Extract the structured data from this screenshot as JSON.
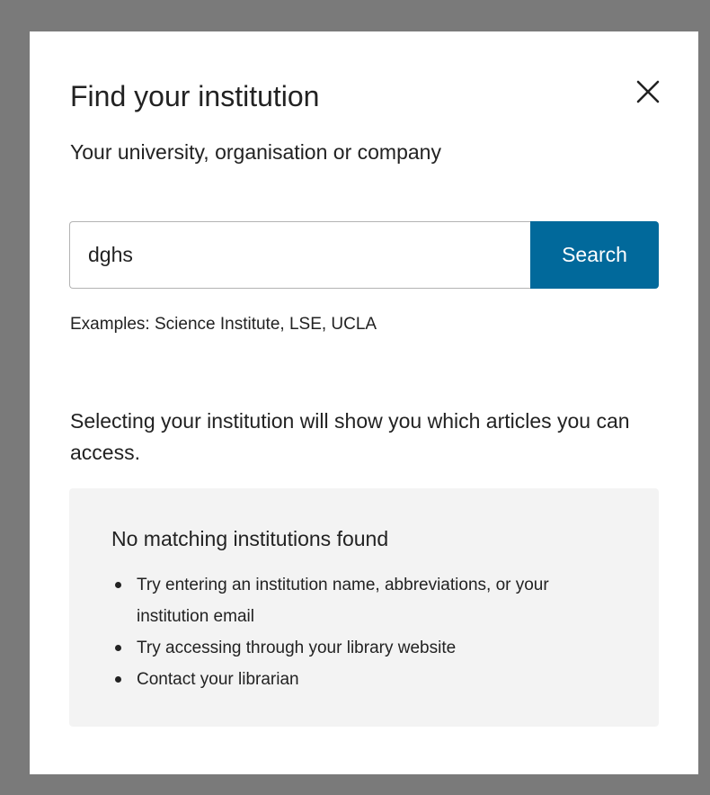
{
  "modal": {
    "title": "Find your institution",
    "subtitle": "Your university, organisation or company",
    "close_icon": "close-icon"
  },
  "search": {
    "value": "dghs",
    "placeholder": "",
    "button_label": "Search",
    "accent_color": "#01699b"
  },
  "examples_text": "Examples: Science Institute, LSE, UCLA",
  "explain_text": "Selecting your institution will show you which articles you can access.",
  "results": {
    "heading": "No matching institutions found",
    "items": [
      {
        "text": "Try entering an institution name, abbreviations, or your institution email"
      },
      {
        "text": "Try accessing through your library website"
      },
      {
        "text": "Contact your librarian"
      }
    ]
  }
}
